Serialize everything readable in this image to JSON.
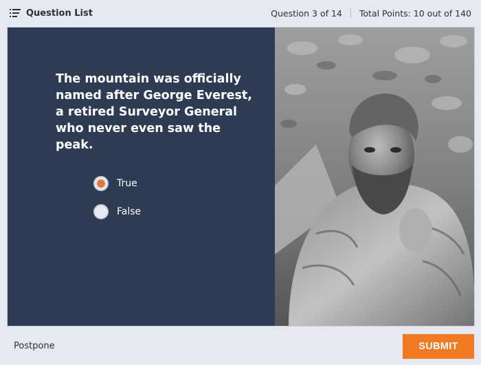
{
  "header": {
    "question_list_label": "Question List",
    "question_counter": "Question 3 of 14",
    "total_points": "Total Points: 10 out of 140"
  },
  "question": {
    "text": "The mountain was officially named after George Everest, a retired Surveyor General who never even saw the peak."
  },
  "options": [
    {
      "label": "True",
      "selected": true
    },
    {
      "label": "False",
      "selected": false
    }
  ],
  "footer": {
    "postpone_label": "Postpone",
    "submit_label": "SUBMIT"
  },
  "colors": {
    "accent": "#f07a22",
    "panel": "#2d3b53",
    "background": "#e6e9f1",
    "radio_selected": "#e6773a"
  },
  "icons": {
    "question_list": "list-icon"
  }
}
